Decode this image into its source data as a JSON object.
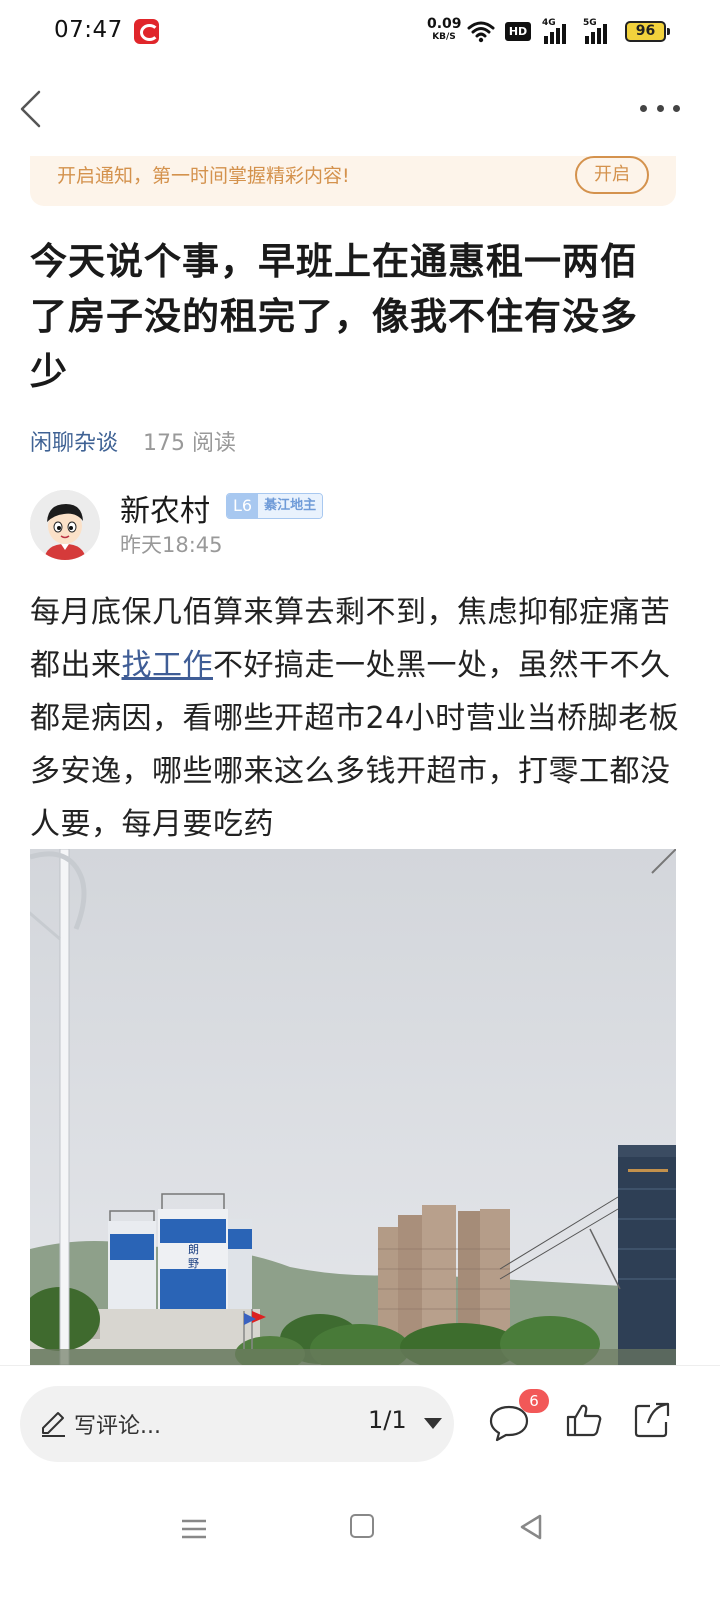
{
  "status_bar": {
    "time": "07:47",
    "net_speed": "0.09",
    "net_unit": "KB/S",
    "hd_label": "HD",
    "sig1_label": "4G",
    "sig2_label": "5G",
    "battery": "96"
  },
  "notify": {
    "text": "开启通知，第一时间掌握精彩内容!",
    "button_label": "开启"
  },
  "post": {
    "title": "今天说个事，早班上在通惠租一两佰了房子没的租完了，像我不住有没多少",
    "category": "闲聊杂谈",
    "read_count": "175 阅读",
    "author": {
      "name": "新农村",
      "level": "L6",
      "level_title": "綦江地主",
      "time": "昨天18:45"
    },
    "body_before_link": "每月底保几佰算来算去剩不到，焦虑抑郁症痛苦都出来",
    "body_link": "找工作",
    "body_after_link": "不好搞走一处黑一处，虽然干不久都是病因，看哪些开超市24小时营业当桥脚老板多安逸，哪些哪来这么多钱开超市，打零工都没人要，每月要吃药",
    "photo_signs": {
      "silo_sign_1": "朗",
      "silo_sign_2": "野"
    }
  },
  "bottom_bar": {
    "comment_placeholder": "写评论...",
    "page_indicator": "1/1",
    "comment_count": "6"
  },
  "colors": {
    "accent_link": "#3f6294",
    "notify_orange": "#d4924d",
    "badge_red": "#f25858",
    "battery_yellow": "#f2d23c"
  },
  "icons": [
    "back-icon",
    "more-icon",
    "pencil-icon",
    "comment-icon",
    "like-icon",
    "share-icon",
    "wifi-icon",
    "menu-icon",
    "home-icon",
    "nav-back-icon"
  ]
}
